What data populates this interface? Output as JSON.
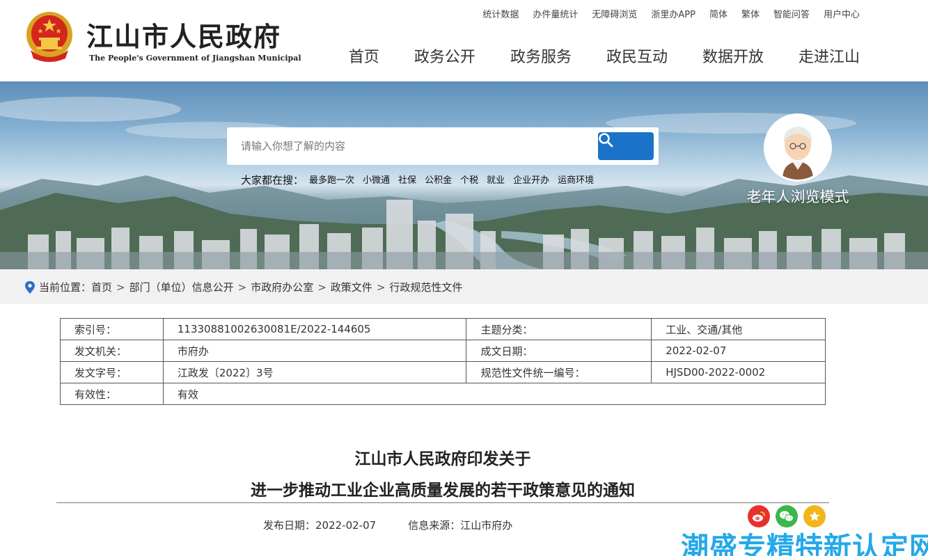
{
  "header": {
    "site_title": "江山市人民政府",
    "site_subtitle": "The People's Government of Jiangshan Municipal",
    "utility_links": [
      "统计数据",
      "办件量统计",
      "无障碍浏览",
      "浙里办APP",
      "简体",
      "繁体",
      "智能问答",
      "用户中心"
    ],
    "nav": [
      "首页",
      "政务公开",
      "政务服务",
      "政民互动",
      "数据开放",
      "走进江山"
    ]
  },
  "banner": {
    "search_placeholder": "请输入你想了解的内容",
    "hot_label": "大家都在搜：",
    "hot_items": [
      "最多跑一次",
      "小微通",
      "社保",
      "公积金",
      "个税",
      "就业",
      "企业开办",
      "运商环境"
    ],
    "elder_mode": "老年人浏览模式"
  },
  "breadcrumb": {
    "label": "当前位置：",
    "items": [
      "首页",
      "部门（单位）信息公开",
      "市政府办公室",
      "政策文件",
      "行政规范性文件"
    ]
  },
  "info_table": {
    "rows": [
      [
        "索引号：",
        "11330881002630081E/2022-144605",
        "主题分类：",
        "工业、交通/其他"
      ],
      [
        "发文机关：",
        "市府办",
        "成文日期：",
        "2022-02-07"
      ],
      [
        "发文字号：",
        "江政发〔2022〕3号",
        "规范性文件统一编号：",
        "HJSD00-2022-0002"
      ],
      [
        "有效性：",
        "有效"
      ]
    ]
  },
  "article": {
    "title_line1": "江山市人民政府印发关于",
    "title_line2": "进一步推动工业企业高质量发展的若干政策意见的通知",
    "publish_date": "发布日期：2022-02-07",
    "source": "信息来源：江山市府办"
  },
  "share": {
    "icons": [
      "weibo-icon",
      "wechat-icon",
      "favorite-icon"
    ],
    "colors": {
      "weibo": "#e6312d",
      "wechat": "#3bb64a",
      "favorite": "#f3b51c"
    }
  },
  "watermark": "潮盛专精特新认定网",
  "colors": {
    "accent": "#1a73c8",
    "breadcrumb_bg": "#f1f1f1"
  }
}
